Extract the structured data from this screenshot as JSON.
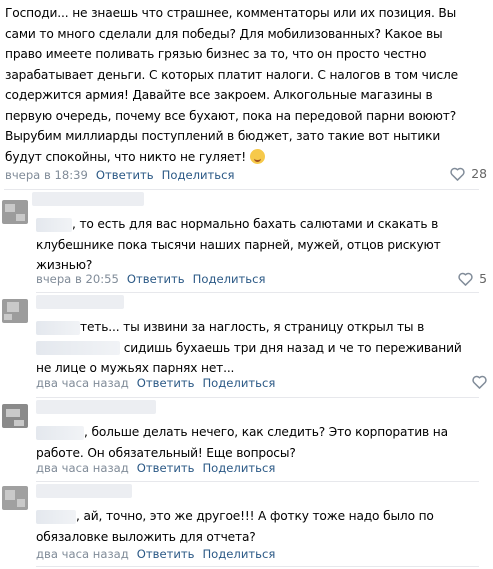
{
  "comments": [
    {
      "text": "Господи... не знаешь что страшнее, комментаторы или их позиция. Вы сами то много сделали для победы? Для мобилизованных? Какое вы право имеете поливать грязью бизнес за то, что он просто честно зарабатывает деньги. С которых платит налоги. С налогов в том числе содержится армия! Давайте все закроем. Алкогольные магазины в первую очередь, почему все бухают, пока на передовой парни воюют? Вырубим миллиарды поступлений в бюджет, зато такие вот нытики будут спокойны, что никто не гуляет!",
      "emoji": "smirk-emoji",
      "time": "вчера в 18:39",
      "reply": "Ответить",
      "share": "Поделиться",
      "likes": "28"
    },
    {
      "text": ", то есть для вас нормально бахать салютами и скакать в клубешнике пока тысячи наших парней, мужей, отцов рискуют жизнью?",
      "time": "вчера в 20:55",
      "reply": "Ответить",
      "share": "Поделиться",
      "likes": "5"
    },
    {
      "text_a": "теть... ты извини за наглость, я страницу открыл ты в",
      "text_b": "сидишь бухаешь три дня назад и че то переживаний не лице о мужьях парнях нет...",
      "time": "два часа назад",
      "reply": "Ответить",
      "share": "Поделиться"
    },
    {
      "text": ", больше делать нечего, как следить? Это корпоратив на работе. Он обязательный! Еще вопросы?",
      "time": "два часа назад",
      "reply": "Ответить",
      "share": "Поделиться"
    },
    {
      "text": ", ай, точно, это же другое!!! А фотку тоже надо было по обязаловке выложить для отчета?",
      "time": "два часа назад",
      "reply": "Ответить",
      "share": "Поделиться"
    }
  ],
  "colors": {
    "link": "#2a5885",
    "meta": "#818c99",
    "divider": "#e7e8ec"
  },
  "icons": {
    "like": "heart-icon"
  }
}
